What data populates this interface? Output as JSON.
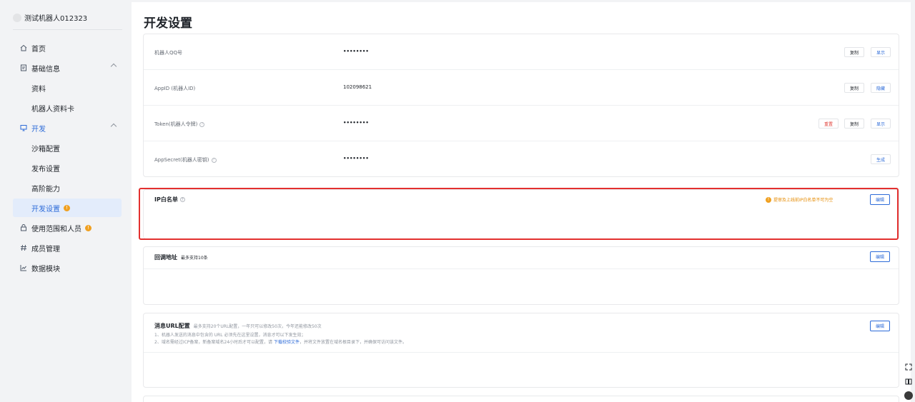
{
  "sidebar": {
    "bot_name": "测试机器人012323",
    "items": [
      {
        "label": "首页",
        "icon": "home-icon"
      },
      {
        "label": "基础信息",
        "icon": "document-icon"
      },
      {
        "label": "资料"
      },
      {
        "label": "机器人资料卡"
      },
      {
        "label": "开发",
        "icon": "monitor-icon"
      },
      {
        "label": "沙箱配置"
      },
      {
        "label": "发布设置"
      },
      {
        "label": "高阶能力"
      },
      {
        "label": "开发设置",
        "badge": "!"
      },
      {
        "label": "使用范围和人员",
        "icon": "lock-icon",
        "badge": "!"
      },
      {
        "label": "成员管理",
        "icon": "hash-icon"
      },
      {
        "label": "数据模块",
        "icon": "chart-icon"
      }
    ]
  },
  "main": {
    "title": "开发设置",
    "credentials": [
      {
        "label": "机器人QQ号",
        "value": "••••••••",
        "actions": [
          "复制",
          "显示"
        ]
      },
      {
        "label": "AppID (机器人ID)",
        "value": "102098621",
        "actions": [
          "复制",
          "隐藏"
        ]
      },
      {
        "label": "Token(机器人令牌)",
        "value": "••••••••",
        "actions": [
          "重置",
          "复制",
          "显示"
        ]
      },
      {
        "label": "AppSecret(机器人密钥)",
        "value": "••••••••",
        "actions": [
          "生成"
        ]
      }
    ],
    "ip_whitelist": {
      "title": "IP白名单",
      "warning": "提审及上线前IP白名单不可为空",
      "edit": "编辑"
    },
    "callback": {
      "title": "回调地址",
      "subtitle": "最多支持10条",
      "edit": "编辑"
    },
    "msg_url": {
      "title": "消息URL配置",
      "subtitle": "最多支持20个URL配置，一年只可以修改50次，今年还能修改50次",
      "note1": "1、机器人发送的消息中包含的 URL 必须先在这里设置，消息才可以下发生效；",
      "note2_prefix": "2、域名需经过ICP备案，新备案域名24小时后才可以配置，请 ",
      "note2_link": "下载校验文件",
      "note2_suffix": "，并将文件放置在域名根目录下，并确保可访问该文件。",
      "edit": "编辑"
    }
  },
  "colors": {
    "accent": "#2d6bd8",
    "warning": "#f0a020",
    "danger": "#e0403a",
    "highlight": "#e3302f"
  }
}
